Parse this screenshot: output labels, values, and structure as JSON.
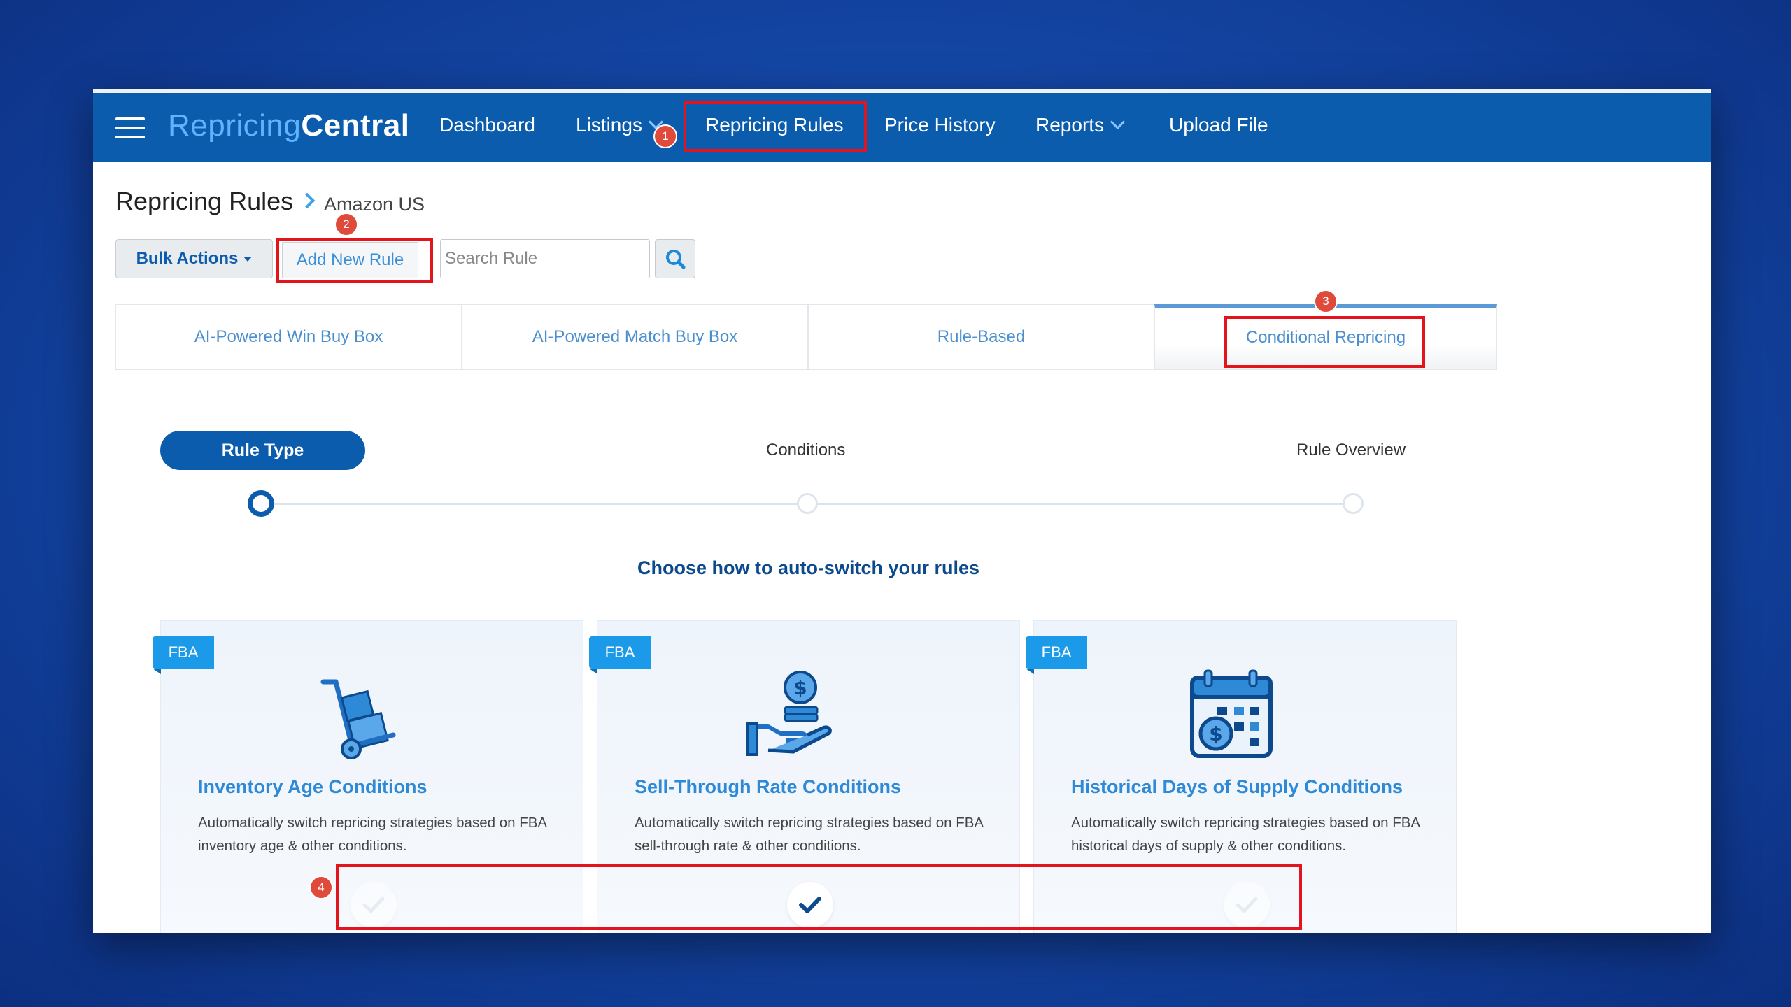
{
  "brand": {
    "part1": "Repricing",
    "part2": "Central"
  },
  "nav": {
    "dashboard": "Dashboard",
    "listings": "Listings",
    "repricing_rules": "Repricing Rules",
    "price_history": "Price History",
    "reports": "Reports",
    "upload_file": "Upload File"
  },
  "page": {
    "title": "Repricing Rules",
    "breadcrumb": "Amazon US"
  },
  "toolbar": {
    "bulk_actions": "Bulk Actions",
    "add_new_rule": "Add New Rule",
    "search_placeholder": "Search Rule"
  },
  "tabs": [
    {
      "label": "AI-Powered Win Buy Box"
    },
    {
      "label": "AI-Powered Match Buy Box"
    },
    {
      "label": "Rule-Based"
    },
    {
      "label": "Conditional Repricing",
      "active": true
    }
  ],
  "stepper": {
    "steps": [
      "Rule Type",
      "Conditions",
      "Rule Overview"
    ],
    "active_index": 0
  },
  "heading": "Choose how to auto-switch your rules",
  "cards": [
    {
      "badge": "FBA",
      "icon": "hand-truck-icon",
      "title": "Inventory Age Conditions",
      "description": "Automatically switch repricing strategies based on FBA inventory age & other conditions.",
      "selected": false
    },
    {
      "badge": "FBA",
      "icon": "hand-coin-icon",
      "title": "Sell-Through Rate Conditions",
      "description": "Automatically switch repricing strategies based on FBA sell-through rate & other conditions.",
      "selected": true
    },
    {
      "badge": "FBA",
      "icon": "calendar-dollar-icon",
      "title": "Historical Days of Supply Conditions",
      "description": "Automatically switch repricing strategies based on FBA historical days of supply & other conditions.",
      "selected": false
    }
  ],
  "annotations": [
    "1",
    "2",
    "3",
    "4"
  ],
  "colors": {
    "primary": "#0b5cad",
    "accent": "#2e8ad6",
    "highlight": "#e3141b",
    "badge": "#e04a3a",
    "fba": "#1a9ae8"
  }
}
